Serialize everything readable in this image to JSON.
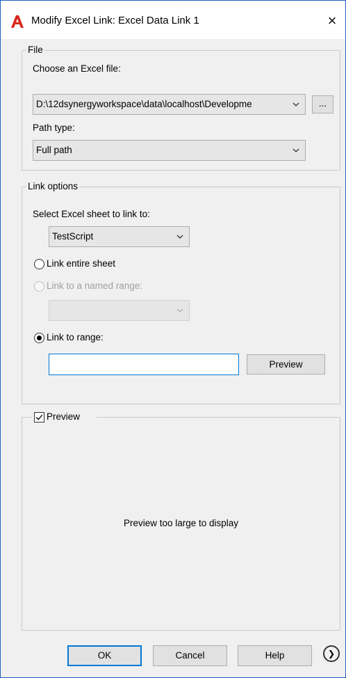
{
  "window": {
    "title": "Modify Excel Link: Excel Data Link 1",
    "close_glyph": "×",
    "app_icon": "autocad-a-icon",
    "accent_color": "#0078d7"
  },
  "file_group": {
    "title": "File",
    "choose_label": "Choose an Excel file:",
    "file_value": "D:\\12dsynergyworkspace\\data\\localhost\\Developme",
    "browse_label": "...",
    "path_type_label": "Path type:",
    "path_type_value": "Full path"
  },
  "link_group": {
    "title": "Link options",
    "sheet_label": "Select Excel sheet to link to:",
    "sheet_value": "TestScript",
    "radio_entire": "Link entire sheet",
    "radio_named": "Link to a named range:",
    "named_range_value": "",
    "radio_range": "Link to range:",
    "range_value": "",
    "preview_button": "Preview"
  },
  "preview_group": {
    "checkbox_label": "Preview",
    "checked": true,
    "message": "Preview too large to display"
  },
  "footer": {
    "ok": "OK",
    "cancel": "Cancel",
    "help": "Help",
    "expand_glyph": "❯"
  }
}
